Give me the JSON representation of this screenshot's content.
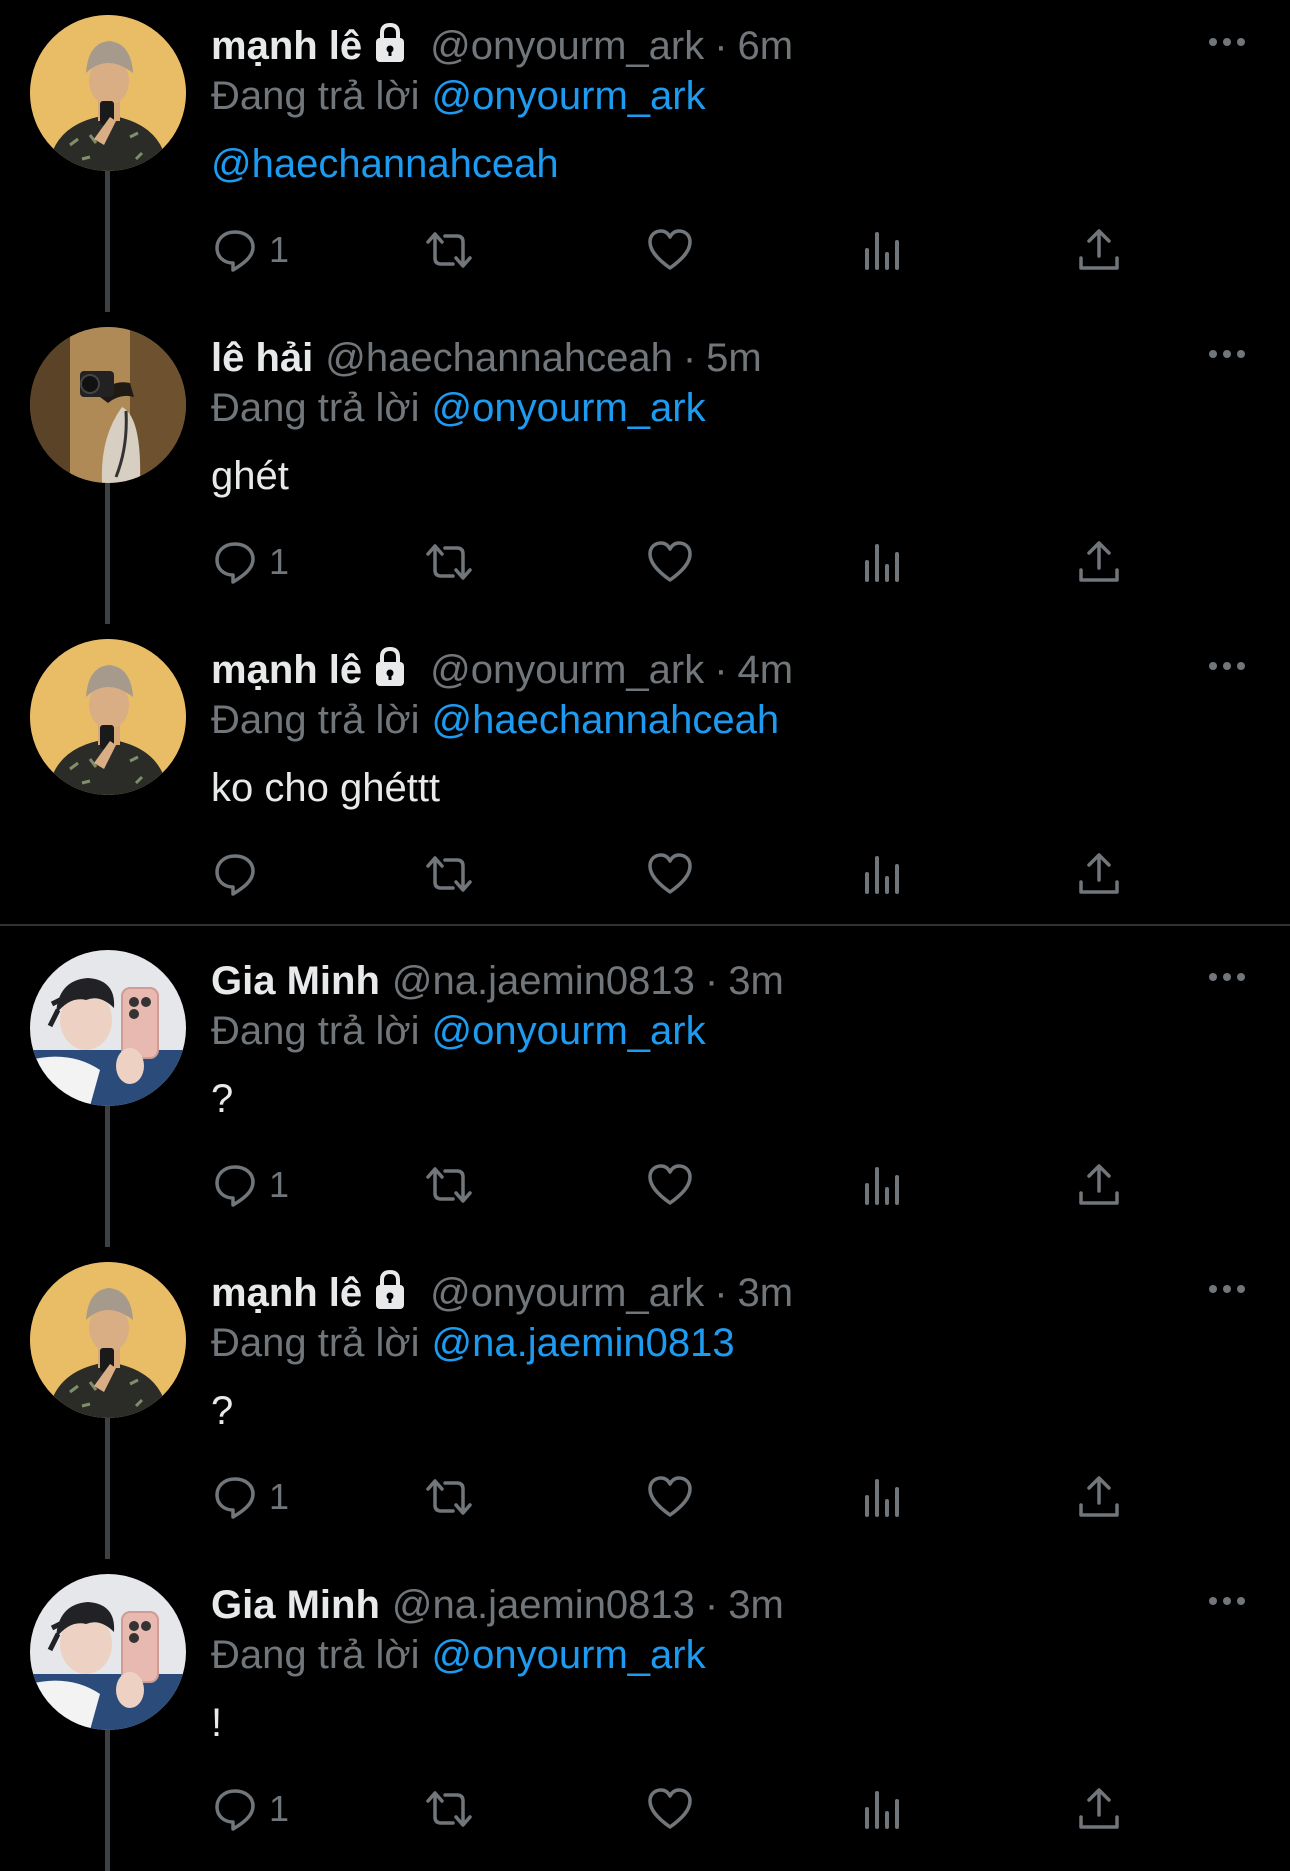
{
  "colors": {
    "background": "#000000",
    "primary_text": "#e7e9ea",
    "secondary_text": "#71767b",
    "link": "#1d9bf0",
    "thread_line": "#3e4144",
    "divider": "#2f3336"
  },
  "reply_prefix": "Đang trả lời",
  "separator": "·",
  "tweets": [
    {
      "name": "mạnh lê",
      "protected": true,
      "handle": "@onyourm_ark",
      "time": "6m",
      "reply_to": "@onyourm_ark",
      "text": "@haechannahceah",
      "reply_count": "1",
      "avatar": "avatar-manh-le"
    },
    {
      "name": "lê hải",
      "protected": false,
      "handle": "@haechannahceah",
      "time": "5m",
      "reply_to": "@onyourm_ark",
      "text": "ghét",
      "reply_count": "1",
      "avatar": "avatar-le-hai"
    },
    {
      "name": "mạnh lê",
      "protected": true,
      "handle": "@onyourm_ark",
      "time": "4m",
      "reply_to": "@haechannahceah",
      "text": "ko cho ghéttt",
      "reply_count": "",
      "avatar": "avatar-manh-le"
    },
    {
      "name": "Gia Minh",
      "protected": false,
      "handle": "@na.jaemin0813",
      "time": "3m",
      "reply_to": "@onyourm_ark",
      "text": "?",
      "reply_count": "1",
      "avatar": "avatar-gia-minh"
    },
    {
      "name": "mạnh lê",
      "protected": true,
      "handle": "@onyourm_ark",
      "time": "3m",
      "reply_to": "@na.jaemin0813",
      "text": "?",
      "reply_count": "1",
      "avatar": "avatar-manh-le"
    },
    {
      "name": "Gia Minh",
      "protected": false,
      "handle": "@na.jaemin0813",
      "time": "3m",
      "reply_to": "@onyourm_ark",
      "text": "!",
      "reply_count": "1",
      "avatar": "avatar-gia-minh"
    }
  ],
  "action_icons": [
    "reply-icon",
    "retweet-icon",
    "like-icon",
    "views-icon",
    "share-icon"
  ],
  "more_icon": "more-options-icon",
  "lock_icon": "lock-icon"
}
